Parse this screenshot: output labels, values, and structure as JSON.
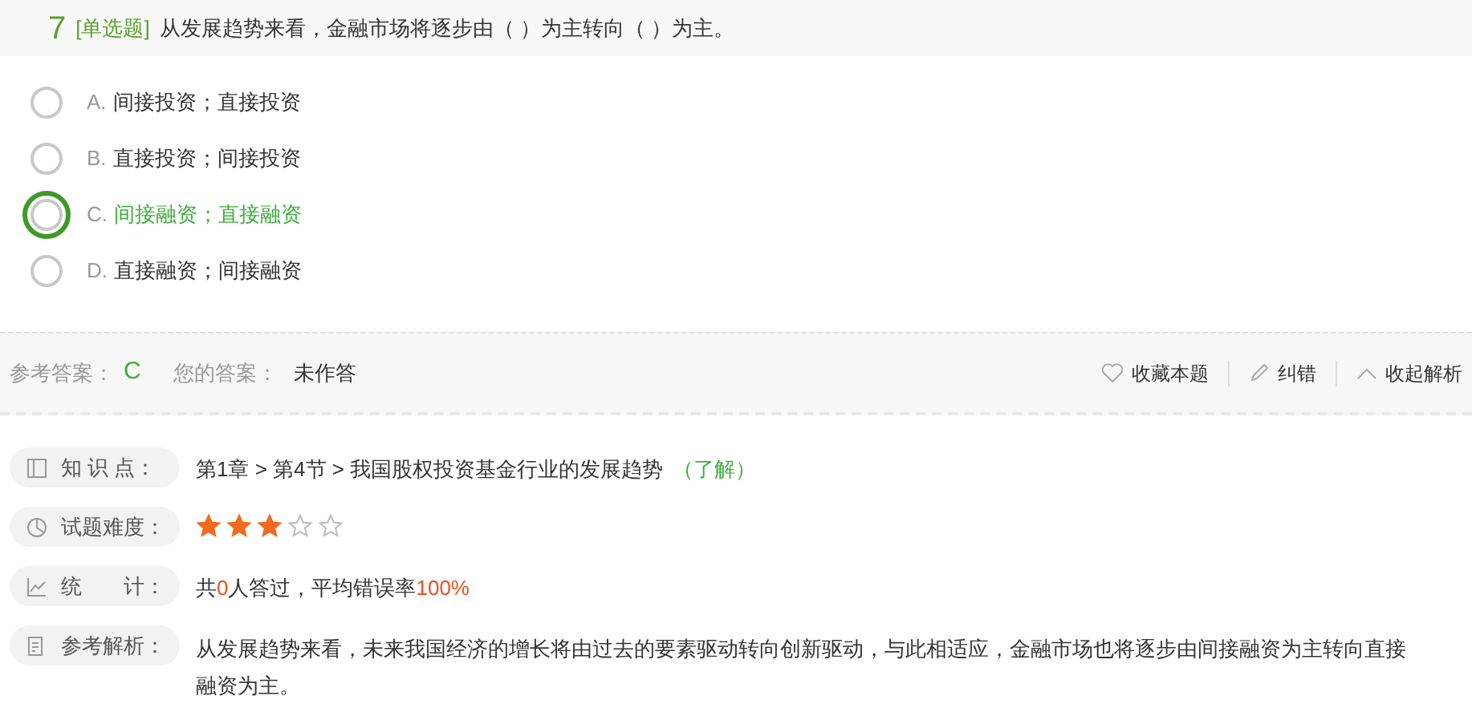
{
  "question": {
    "number": "7",
    "type": "[单选题]",
    "text": "从发展趋势来看，金融市场将逐步由（ ）为主转向（ ）为主。"
  },
  "options": [
    {
      "letter": "A.",
      "text": "间接投资；直接投资",
      "correct": false
    },
    {
      "letter": "B.",
      "text": "直接投资；间接投资",
      "correct": false
    },
    {
      "letter": "C.",
      "text": "间接融资；直接融资",
      "correct": true
    },
    {
      "letter": "D.",
      "text": "直接融资；间接融资",
      "correct": false
    }
  ],
  "answer_bar": {
    "reference_label": "参考答案：",
    "reference": "C",
    "yours_label": "您的答案：",
    "yours": "未作答",
    "actions": [
      {
        "kind": "favorite",
        "label": "收藏本题"
      },
      {
        "kind": "report",
        "label": "纠错"
      },
      {
        "kind": "collapse",
        "label": "收起解析"
      }
    ]
  },
  "details": [
    {
      "kind": "knowledge",
      "label": "知 识 点：",
      "path": "第1章 > 第4节 > 我国股权投资基金行业的发展趋势",
      "level": "（了解）"
    },
    {
      "kind": "difficulty",
      "label": "试题难度：",
      "stars": 3
    },
    {
      "kind": "stats",
      "label": "统　　计：",
      "parts": [
        {
          "text": "共",
          "highlight": false
        },
        {
          "text": "0",
          "highlight": true
        },
        {
          "text": "人答过，平均错误率",
          "highlight": false
        },
        {
          "text": "100%",
          "highlight": true
        }
      ]
    },
    {
      "kind": "analysis",
      "label": "参考解析：",
      "text": "从发展趋势来看，未来我国经济的增长将由过去的要素驱动转向创新驱动，与此相适应，金融市场也将逐步由间接融资为主转向直接融资为主。"
    }
  ]
}
